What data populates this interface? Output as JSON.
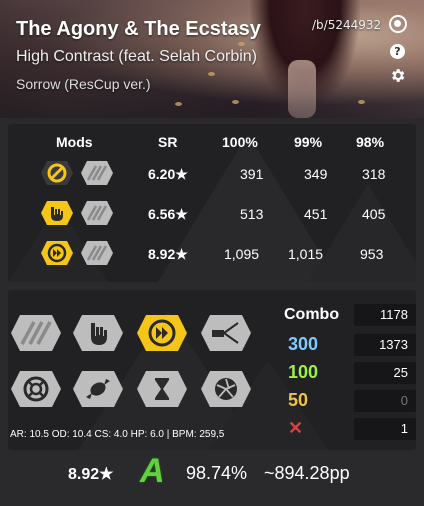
{
  "beatmap": {
    "title": "The Agony & The Ecstasy",
    "artist": "High Contrast (feat. Selah Corbin)",
    "difficulty": "Sorrow (ResCup ver.)",
    "link": "/b/5244932"
  },
  "header_icons": [
    "osu-icon",
    "help-icon",
    "gear-icon"
  ],
  "table": {
    "headers": [
      "Mods",
      "SR",
      "100%",
      "99%",
      "98%"
    ],
    "rows": [
      {
        "mods": [
          "no-fail-icon",
          "auto-icon"
        ],
        "sr": "6.20★",
        "v100": "391",
        "v99": "349",
        "v98": "318"
      },
      {
        "mods": [
          "hard-rock-icon",
          "auto-icon"
        ],
        "sr": "6.56★",
        "v100": "513",
        "v99": "451",
        "v98": "405"
      },
      {
        "mods": [
          "double-time-icon",
          "auto-icon"
        ],
        "sr": "8.92★",
        "v100": "1,095",
        "v99": "1,015",
        "v98": "953"
      }
    ]
  },
  "mods": [
    {
      "name": "easy-mod",
      "icon": "easy-icon",
      "active": false
    },
    {
      "name": "hard-rock-mod",
      "icon": "hard-rock-icon",
      "active": false
    },
    {
      "name": "double-time-mod",
      "icon": "double-time-icon",
      "active": true
    },
    {
      "name": "flashlight-mod",
      "icon": "flashlight-icon",
      "active": false
    },
    {
      "name": "no-fail-mod",
      "icon": "no-fail-icon",
      "active": false
    },
    {
      "name": "candy-mod",
      "icon": "candy-icon",
      "active": false
    },
    {
      "name": "half-time-mod",
      "icon": "hourglass-icon",
      "active": false
    },
    {
      "name": "spun-out-mod",
      "icon": "spinner-icon",
      "active": false
    }
  ],
  "map_stats": "AR: 10.5 OD: 10.4 CS: 4.0 HP: 6.0 | BPM: 259,5",
  "combo": {
    "label": "Combo",
    "value": "1178"
  },
  "hits": [
    {
      "label": "300",
      "value": "1373",
      "color": "#7ecbff"
    },
    {
      "label": "100",
      "value": "25",
      "color": "#9bf04a"
    },
    {
      "label": "50",
      "value": "0",
      "color": "#f0c24a"
    },
    {
      "label": "✕",
      "value": "1",
      "color": "#e53b3b"
    }
  ],
  "summary": {
    "stars": "8.92★",
    "grade": "A",
    "accuracy": "98.74%",
    "pp": "~894.28pp"
  },
  "colors": {
    "accent_yellow": "#f5c518",
    "grey_button": "#bdbdbd",
    "panel": "#212124",
    "background": "#2a2a2c"
  }
}
